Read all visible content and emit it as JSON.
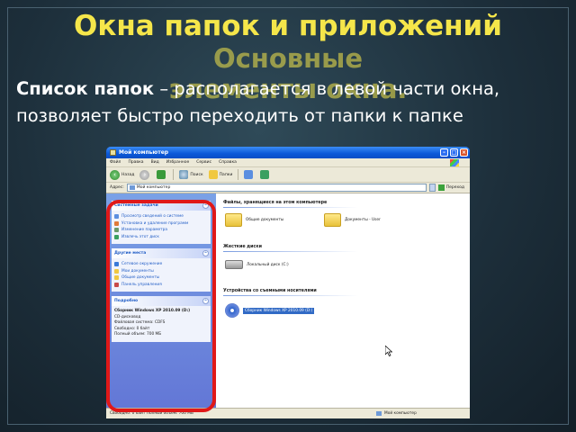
{
  "slide": {
    "title": "Окна папок и приложений",
    "overlap_title_line1": "Основные",
    "overlap_title_line2": "элементы окна.",
    "desc_bold": "Список папок",
    "desc_rest": " – располагается в левой части окна, позволяет быстро переходить от папки к папке"
  },
  "window": {
    "title": "Мой компьютер",
    "menu": [
      "Файл",
      "Правка",
      "Вид",
      "Избранное",
      "Сервис",
      "Справка"
    ],
    "toolbar": {
      "back": "Назад",
      "search": "Поиск",
      "folders": "Папки"
    },
    "address": {
      "label": "Адрес:",
      "value": "Мой компьютер",
      "go": "Переход"
    },
    "sidebar": {
      "system_tasks": {
        "header": "Системные задачи",
        "items": [
          "Просмотр сведений о системе",
          "Установка и удаление программ",
          "Изменение параметра",
          "Извлечь этот диск"
        ]
      },
      "other_places": {
        "header": "Другие места",
        "items": [
          "Сетевое окружение",
          "Мои документы",
          "Общие документы",
          "Панель управления"
        ]
      },
      "details": {
        "header": "Подробно",
        "lines": [
          "Сборник Windows XP 2010.09 (D:)",
          "CD-дисковод",
          "Файловая система: CDFS",
          "Свободно: 0 байт",
          "Полный объем: 700 МБ"
        ]
      }
    },
    "main": {
      "group_files": "Файлы, хранящиеся на этом компьютере",
      "shared_docs": "Общие документы",
      "user_docs": "Документы - User",
      "group_hdd": "Жесткие диски",
      "local_disk": "Локальный диск (C:)",
      "group_removable": "Устройства со съемными носителями",
      "cd_drive": "Сборник Windows XP 2010.09 (D:)"
    },
    "status": {
      "left": "Свободно: 0 байт Полный объем: 700 МБ",
      "right": "Мой компьютер"
    }
  },
  "colors": {
    "title": "#f5e64a",
    "highlight": "#e01818",
    "sidebar_link": "#215dc6"
  }
}
